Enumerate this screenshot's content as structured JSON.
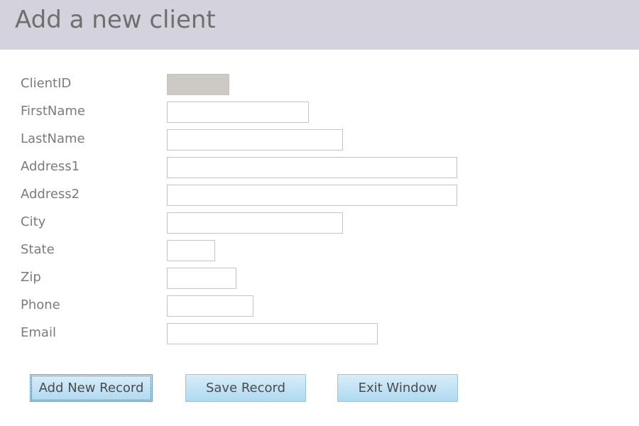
{
  "header": {
    "title": "Add a new client"
  },
  "fields": {
    "client_id": {
      "label": "ClientID",
      "value": ""
    },
    "first_name": {
      "label": "FirstName",
      "value": ""
    },
    "last_name": {
      "label": "LastName",
      "value": ""
    },
    "address1": {
      "label": "Address1",
      "value": ""
    },
    "address2": {
      "label": "Address2",
      "value": ""
    },
    "city": {
      "label": "City",
      "value": ""
    },
    "state": {
      "label": "State",
      "value": ""
    },
    "zip": {
      "label": "Zip",
      "value": ""
    },
    "phone": {
      "label": "Phone",
      "value": ""
    },
    "email": {
      "label": "Email",
      "value": ""
    }
  },
  "buttons": {
    "add_new_record": "Add New Record",
    "save_record": "Save Record",
    "exit_window": "Exit Window"
  },
  "colors": {
    "header_background": "#d4d2dd",
    "readonly_field": "#cdcac6",
    "button_gradient_top": "#d9eef9",
    "button_gradient_bottom": "#aedaf2"
  }
}
